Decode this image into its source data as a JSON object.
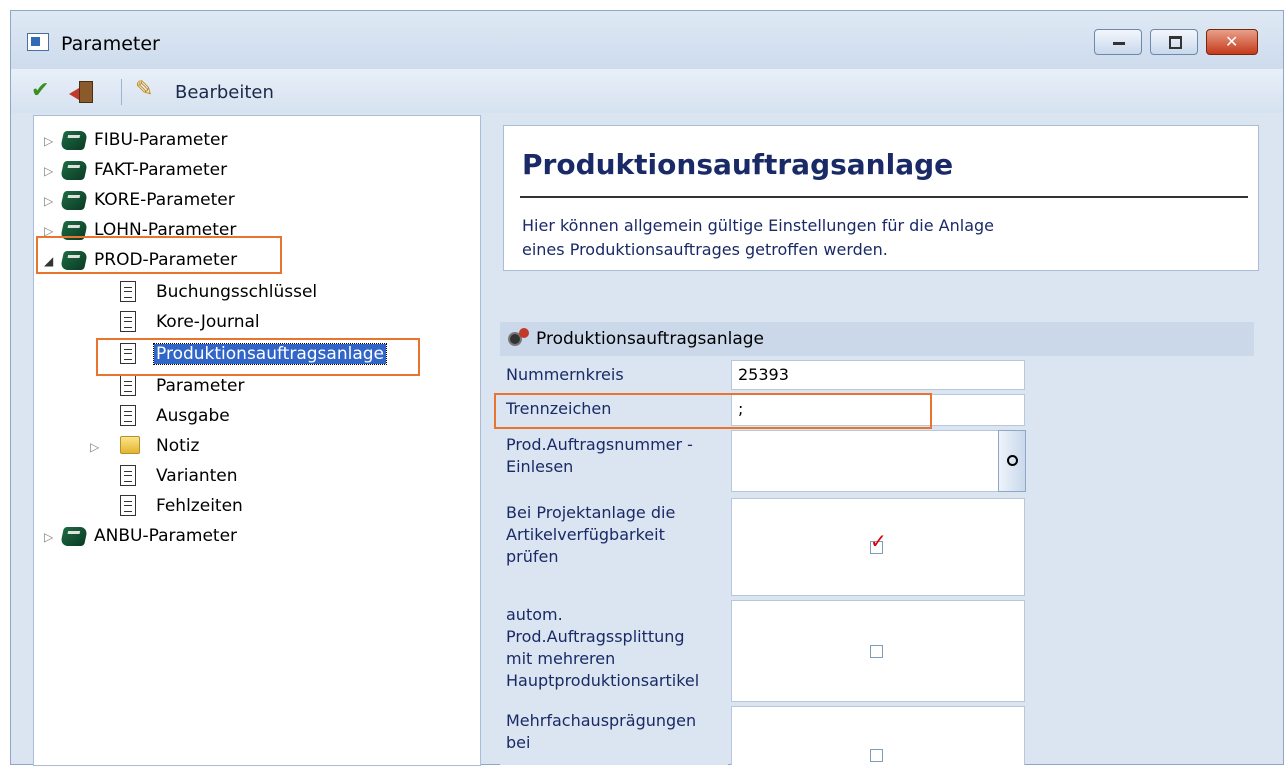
{
  "window": {
    "title": "Parameter"
  },
  "toolbar": {
    "edit_label": "Bearbeiten"
  },
  "tree": {
    "items": [
      {
        "label": "FIBU-Parameter"
      },
      {
        "label": "FAKT-Parameter"
      },
      {
        "label": "KORE-Parameter"
      },
      {
        "label": "LOHN-Parameter"
      },
      {
        "label": "PROD-Parameter"
      },
      {
        "label": "Buchungsschlüssel"
      },
      {
        "label": "Kore-Journal"
      },
      {
        "label": "Produktionsauftragsanlage"
      },
      {
        "label": "Parameter"
      },
      {
        "label": "Ausgabe"
      },
      {
        "label": "Notiz"
      },
      {
        "label": "Varianten"
      },
      {
        "label": "Fehlzeiten"
      },
      {
        "label": "ANBU-Parameter"
      }
    ]
  },
  "content": {
    "title": "Produktionsauftragsanlage",
    "description_line1": "Hier können allgemein gültige Einstellungen für die Anlage",
    "description_line2": "eines Produktionsauftrages getroffen werden.",
    "section_title": "Produktionsauftragsanlage",
    "fields": {
      "nummernkreis_label": "Nummernkreis",
      "nummernkreis_value": "25393",
      "trennzeichen_label": "Trennzeichen",
      "trennzeichen_value": ";",
      "einlesen_label_1": "Prod.Auftragsnummer -",
      "einlesen_label_2": "Einlesen",
      "einlesen_value": "",
      "projekt_label_1": "Bei Projektanlage die",
      "projekt_label_2": "Artikelverfügbarkeit",
      "projekt_label_3": "prüfen",
      "projekt_checked": true,
      "split_label_1": "autom.",
      "split_label_2": "Prod.Auftragssplittung",
      "split_label_3": "mit mehreren",
      "split_label_4": "Hauptproduktionsartikel",
      "split_checked": false,
      "mehrfach_label_1": "Mehrfachausprägungen",
      "mehrfach_label_2": "bei",
      "mehrfach_checked": false
    }
  },
  "colors": {
    "highlight_box": "#e8742f",
    "selection": "#3165c8",
    "title": "#1a2a66"
  }
}
